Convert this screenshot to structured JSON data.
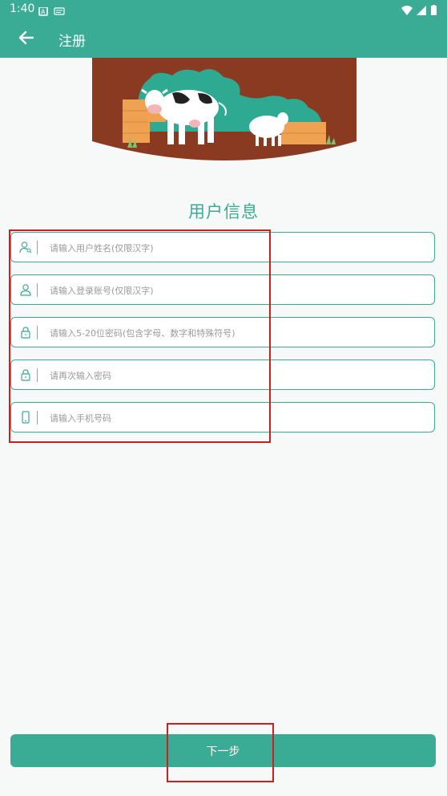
{
  "status_bar": {
    "time": "1:40"
  },
  "app_bar": {
    "title": "注册",
    "back_icon": "arrow-back-icon"
  },
  "form": {
    "section_title": "用户信息",
    "fields": [
      {
        "icon": "user-search-icon",
        "placeholder": "请输入用户姓名(仅限汉字)",
        "value": ""
      },
      {
        "icon": "user-icon",
        "placeholder": "请输入登录账号(仅限汉字)",
        "value": ""
      },
      {
        "icon": "lock-icon",
        "placeholder": "请输入5-20位密码(包含字母、数字和特殊符号)",
        "value": ""
      },
      {
        "icon": "lock-icon",
        "placeholder": "请再次输入密码",
        "value": ""
      },
      {
        "icon": "phone-icon",
        "placeholder": "请输入手机号码",
        "value": ""
      }
    ]
  },
  "footer": {
    "next_label": "下一步"
  },
  "colors": {
    "primary": "#3aab95",
    "banner_brown": "#8b3a22",
    "highlight": "#d01e1e"
  }
}
